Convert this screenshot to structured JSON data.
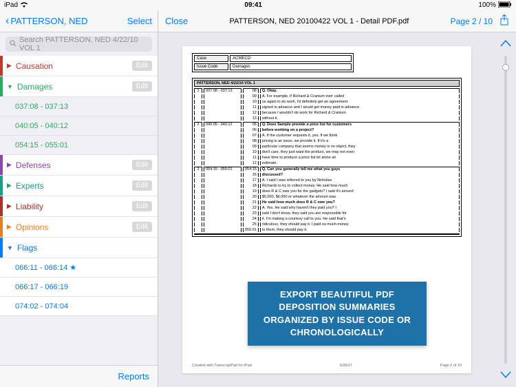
{
  "status": {
    "carrier": "iPad",
    "wifi": "●●●",
    "time": "09:41",
    "battery": "100%"
  },
  "sidebar": {
    "back": "PATTERSON, NED",
    "select": "Select",
    "search_placeholder": "Search PATTERSON, NED 4/22/10 VOL 1",
    "edit": "Edit",
    "reports": "Reports",
    "issues": [
      {
        "label": "Causation",
        "color": "red",
        "open": false
      },
      {
        "label": "Damages",
        "color": "green",
        "open": true,
        "subs": [
          "037:08 - 037:13",
          "040:05 - 040:12",
          "054:15 - 055:01"
        ]
      },
      {
        "label": "Defenses",
        "color": "purple",
        "open": false
      },
      {
        "label": "Experts",
        "color": "dgreen",
        "open": false
      },
      {
        "label": "Liability",
        "color": "dred",
        "open": false
      },
      {
        "label": "Opinions",
        "color": "orange",
        "open": false
      },
      {
        "label": "Flags",
        "color": "blue",
        "open": true,
        "subs": [
          "066:11 - 066:14 ★",
          "066:17 - 066:19",
          "074:02 - 074:04"
        ],
        "flag": true
      }
    ]
  },
  "header": {
    "close": "Close",
    "title": "PATTERSON, NED 20100422 VOL 1 - Detail PDF.pdf",
    "page": "Page 2 / 10"
  },
  "pdf": {
    "meta": {
      "case_k": "Case",
      "case_v": "ACMECO",
      "issue_k": "Issue Code",
      "issue_v": "Damages"
    },
    "depo_title": "PATTERSON, NED 4/22/10 VOL 1",
    "rows": [
      {
        "n": "1",
        "range": "037:08 - 037:13",
        "lines": [
          [
            "08",
            "Q.   Okay."
          ],
          [
            "09",
            "A.   For example, if Richard & Cranium ever called"
          ],
          [
            "10",
            "us again to do work, I'd definitely get an agreement"
          ],
          [
            "11",
            "signed in advance and I would get money paid in advance"
          ],
          [
            "12",
            "because I wouldn't do work for Richard & Cranium"
          ],
          [
            "13",
            "without it."
          ]
        ]
      },
      {
        "n": "2",
        "range": "040:05 - 040:12",
        "lines": [
          [
            "05",
            "Q.   Does Sample provide a price list for customers"
          ],
          [
            "06",
            "before working on a project?"
          ],
          [
            "07",
            "A.   If the customer requests it, yes.  If we think"
          ],
          [
            "08",
            "pricing is an issue, we provide it.  If it's a"
          ],
          [
            "09",
            "particular company that seems money is no object, they"
          ],
          [
            "10",
            "don't care, they just want the product, we may not even"
          ],
          [
            "11",
            "have time to produce a price list let alone an"
          ],
          [
            "12",
            "estimate."
          ]
        ]
      },
      {
        "n": "3",
        "range": "054:15 - 055:01",
        "lines": [
          [
            "054:15",
            "Q.   Can you generally tell me what you guys"
          ],
          [
            "16",
            "discussed?"
          ],
          [
            "17",
            "A.   I said I was referred to you by Nicholas"
          ],
          [
            "18",
            "Richards to try to collect money.  He said how much"
          ],
          [
            "19",
            "does R & C owe you for the gadgets?  I said it's around"
          ],
          [
            "20",
            "$5,000, $6,000 or whatever the amount was."
          ],
          [
            "21",
            "He said how much does R & C owe you?"
          ],
          [
            "22",
            "A.   Yes.  He said why haven't they paid you?  I"
          ],
          [
            "23",
            "said I don't know, they said you are responsible for"
          ],
          [
            "24",
            "it.  I'm making a courtesy call to you.  He said that's"
          ],
          [
            "25",
            "ridiculous, they should pay it.  I paid so much money"
          ],
          [
            "055:01",
            "to them, they should pay it."
          ]
        ]
      }
    ],
    "footer_left": "Created with TranscriptPad for iPad",
    "footer_center": "6/26/17",
    "footer_right": "Page 2 of 10"
  },
  "banner": {
    "line1": "EXPORT BEAUTIFUL PDF DEPOSITION SUMMARIES",
    "line2": "ORGANIZED BY ISSUE CODE OR CHRONOLOGICALLY"
  }
}
